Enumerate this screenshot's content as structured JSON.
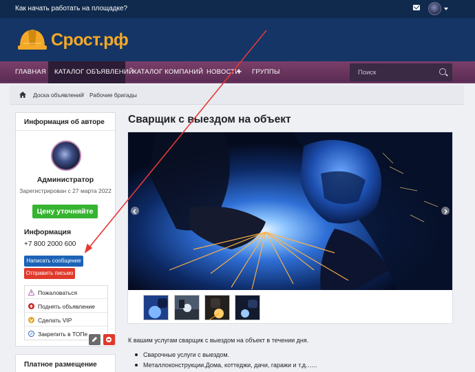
{
  "topbar": {
    "help_link": "Как начать работать на площадке?"
  },
  "logo": {
    "part1": "Срост",
    "part2": ".рф"
  },
  "nav": {
    "items": [
      "ГЛАВНАЯ",
      "КАТАЛОГ ОБЪЯВЛЕНИЙ",
      "КАТАЛОГ КОМПАНИЙ",
      "НОВОСТИ",
      "ГРУППЫ"
    ],
    "news_plus": "+",
    "search_placeholder": "Поиск"
  },
  "breadcrumb": {
    "items": [
      "Доска объявлений",
      "Рабочие бригады"
    ],
    "separator": "/"
  },
  "author_card": {
    "heading": "Информация об авторе",
    "name": "Администратор",
    "registered": "Зарегистрирован с 27 марта 2022",
    "price": "Цену уточняйте",
    "info_heading": "Информация",
    "phone": "+7 800 2000 600",
    "btn_message": "Написать сообщение",
    "btn_email": "Отправить письмо",
    "actions": [
      "Пожаловаться",
      "Поднять объявление",
      "Сделать VIP",
      "Закрепить в ТОПе"
    ]
  },
  "paid_card": {
    "heading": "Платное размещение"
  },
  "listing": {
    "title": "Сварщик с выездом на объект",
    "description": "К вашим услугам сварщик с выездом на объект в течении дня.",
    "bullets": [
      "Сварочные услуги с выездом.",
      "Металлоконструкции.Дома, коттеджи, дачи, гаражи и т.д…..."
    ]
  },
  "colors": {
    "header": "#143566",
    "topbar": "#0f2a4d",
    "nav": "#6b3561",
    "accent": "#f3a927",
    "price_green": "#36b431",
    "btn_blue": "#1c63b7",
    "btn_red": "#e0392b",
    "annotation_red": "#e53935"
  }
}
